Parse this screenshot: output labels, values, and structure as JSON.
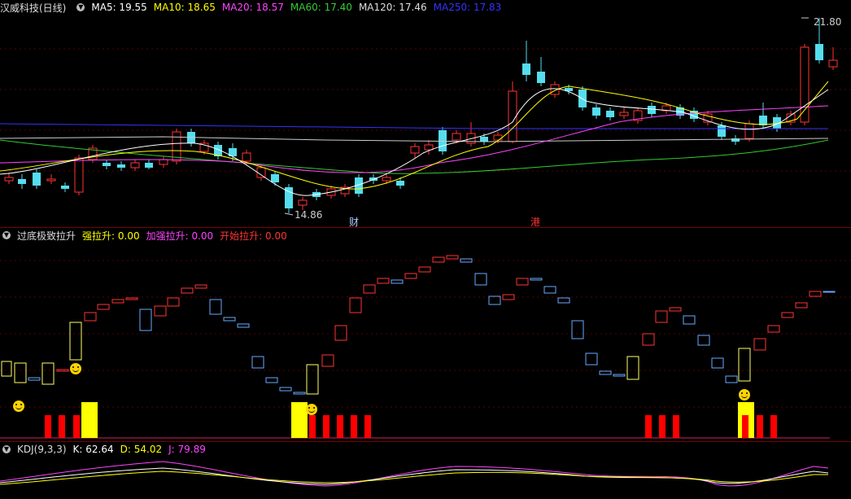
{
  "main": {
    "title": "汉威科技(日线)",
    "indicators": [
      {
        "label": "MA5: 19.55",
        "color": "#ffffff"
      },
      {
        "label": "MA10: 18.65",
        "color": "#ffff00"
      },
      {
        "label": "MA20: 18.57",
        "color": "#ff44ff"
      },
      {
        "label": "MA60: 17.40",
        "color": "#33cc33"
      },
      {
        "label": "MA120: 17.46",
        "color": "#dddddd"
      },
      {
        "label": "MA250: 17.83",
        "color": "#3333ff"
      }
    ],
    "high_label": "21.80",
    "low_label": "14.86",
    "event_cai": "财",
    "event_gang": "港"
  },
  "sub1": {
    "title": "过底极致拉升",
    "indicators": [
      {
        "label": "强拉升: 0.00",
        "color": "#ffff00"
      },
      {
        "label": "加强拉升: 0.00",
        "color": "#ff44ff"
      },
      {
        "label": "开始拉升: 0.00",
        "color": "#ff3333"
      }
    ]
  },
  "sub2": {
    "title": "KDJ(9,3,3)",
    "indicators": [
      {
        "label": "K: 62.64",
        "color": "#ffffff"
      },
      {
        "label": "D: 54.02",
        "color": "#ffff00"
      },
      {
        "label": "J: 79.89",
        "color": "#ff44ff"
      }
    ]
  },
  "colors": {
    "up": "#ff3333",
    "down": "#55ddee",
    "grid": "#7a0000"
  }
}
